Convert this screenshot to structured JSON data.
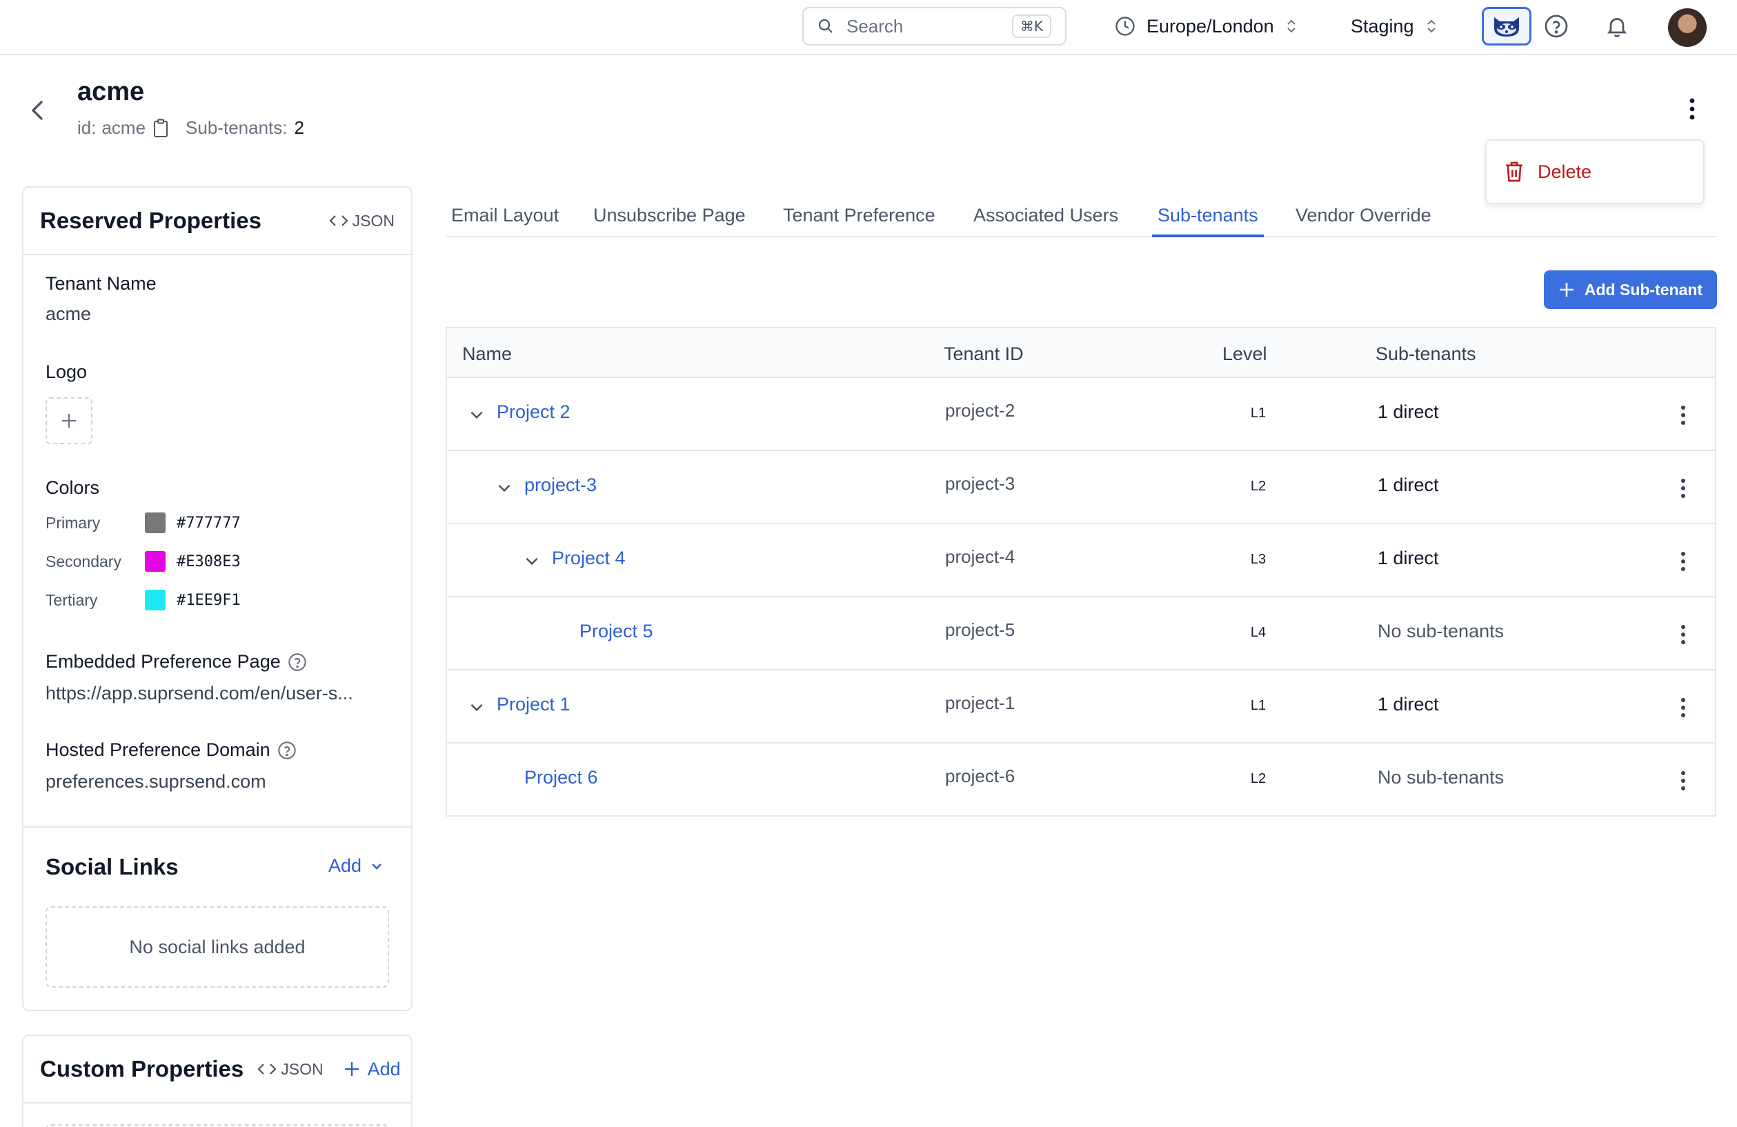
{
  "topbar": {
    "search_placeholder": "Search",
    "search_shortcut": "⌘K",
    "timezone": "Europe/London",
    "environment": "Staging"
  },
  "header": {
    "title": "acme",
    "id_label": "id:",
    "id_value": "acme",
    "subtenants_label": "Sub-tenants:",
    "subtenants_value": "2"
  },
  "context_menu": {
    "delete_label": "Delete"
  },
  "reserved_properties": {
    "title": "Reserved Properties",
    "json_label": "JSON",
    "tenant_name_label": "Tenant Name",
    "tenant_name_value": "acme",
    "logo_label": "Logo",
    "colors_label": "Colors",
    "colors": [
      {
        "name": "Primary",
        "hex": "#777777"
      },
      {
        "name": "Secondary",
        "hex": "#E308E3"
      },
      {
        "name": "Tertiary",
        "hex": "#1EE9F1"
      }
    ],
    "embedded_pref_label": "Embedded Preference Page",
    "embedded_pref_value": "https://app.suprsend.com/en/user-s...",
    "hosted_domain_label": "Hosted Preference Domain",
    "hosted_domain_value": "preferences.suprsend.com",
    "social_links_title": "Social Links",
    "social_add_label": "Add",
    "social_empty": "No social links added"
  },
  "custom_properties": {
    "title": "Custom Properties",
    "json_label": "JSON",
    "add_label": "Add"
  },
  "tabs": [
    {
      "label": "Email Layout",
      "active": false
    },
    {
      "label": "Unsubscribe Page",
      "active": false
    },
    {
      "label": "Tenant Preference",
      "active": false
    },
    {
      "label": "Associated Users",
      "active": false
    },
    {
      "label": "Sub-tenants",
      "active": true
    },
    {
      "label": "Vendor Override",
      "active": false
    }
  ],
  "add_subtenant_label": "Add Sub-tenant",
  "table": {
    "columns": [
      "Name",
      "Tenant ID",
      "Level",
      "Sub-tenants"
    ],
    "rows": [
      {
        "name": "Project 2",
        "tenant_id": "project-2",
        "level": "L1",
        "subtenants": "1 direct",
        "expanded": true
      },
      {
        "name": "project-3",
        "tenant_id": "project-3",
        "level": "L2",
        "subtenants": "1 direct",
        "expanded": true
      },
      {
        "name": "Project 4",
        "tenant_id": "project-4",
        "level": "L3",
        "subtenants": "1 direct",
        "expanded": true
      },
      {
        "name": "Project 5",
        "tenant_id": "project-5",
        "level": "L4",
        "subtenants": "No sub-tenants",
        "expanded": false
      },
      {
        "name": "Project 1",
        "tenant_id": "project-1",
        "level": "L1",
        "subtenants": "1 direct",
        "expanded": true
      },
      {
        "name": "Project 6",
        "tenant_id": "project-6",
        "level": "L2",
        "subtenants": "No sub-tenants",
        "expanded": false
      }
    ]
  },
  "colors": {
    "accent": "#3b6fe0",
    "link": "#2f5fd0",
    "danger": "#b91c1c",
    "border": "#e5e7eb"
  }
}
